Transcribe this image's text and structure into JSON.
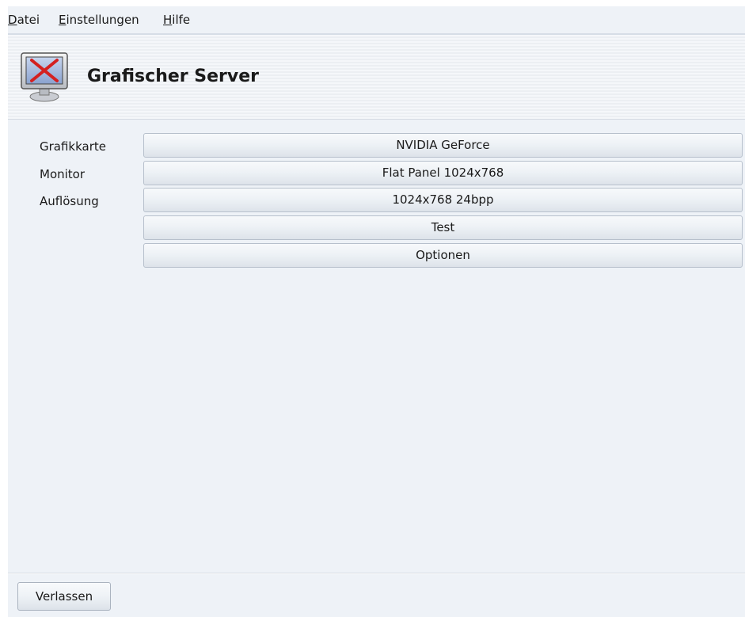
{
  "menu": {
    "items": [
      {
        "mnemonic": "D",
        "rest": "atei"
      },
      {
        "mnemonic": "E",
        "rest": "instellungen"
      },
      {
        "mnemonic": "H",
        "rest": "ilfe"
      }
    ]
  },
  "header": {
    "title": "Grafischer Server",
    "icon": "monitor-x-icon"
  },
  "fields": {
    "labels": [
      "Grafikkarte",
      "Monitor",
      "Auflösung"
    ],
    "buttons": [
      "NVIDIA GeForce",
      "Flat Panel 1024x768",
      "1024x768 24bpp",
      "Test",
      "Optionen"
    ]
  },
  "footer": {
    "quit_label": "Verlassen"
  },
  "colors": {
    "background": "#eef2f7",
    "x_red": "#d42020",
    "screen_blue": "#9db3da"
  }
}
